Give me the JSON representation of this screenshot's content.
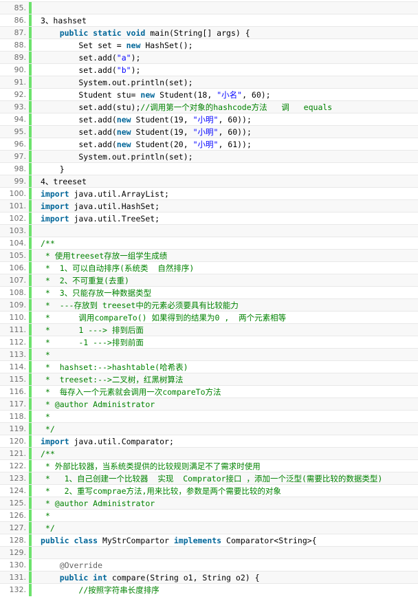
{
  "viewer": {
    "kind": "code-listing",
    "first_line": 85,
    "last_line": 132
  },
  "lines": [
    {
      "n": "85.",
      "t": []
    },
    {
      "n": "86.",
      "t": [
        [
          "blk",
          "3、hashset"
        ]
      ]
    },
    {
      "n": "87.",
      "t": [
        [
          "blk",
          "    "
        ],
        [
          "kw",
          "public static void"
        ],
        [
          "blk",
          " main(String[] args) {"
        ]
      ]
    },
    {
      "n": "88.",
      "t": [
        [
          "blk",
          "        Set set = "
        ],
        [
          "kw",
          "new"
        ],
        [
          "blk",
          " HashSet();"
        ]
      ]
    },
    {
      "n": "89.",
      "t": [
        [
          "blk",
          "        set.add("
        ],
        [
          "str",
          "\"a\""
        ],
        [
          "blk",
          ");"
        ]
      ]
    },
    {
      "n": "90.",
      "t": [
        [
          "blk",
          "        set.add("
        ],
        [
          "str",
          "\"b\""
        ],
        [
          "blk",
          ");"
        ]
      ]
    },
    {
      "n": "91.",
      "t": [
        [
          "blk",
          "        System.out.println(set);"
        ]
      ]
    },
    {
      "n": "92.",
      "t": [
        [
          "blk",
          "        Student stu= "
        ],
        [
          "kw",
          "new"
        ],
        [
          "blk",
          " Student(18, "
        ],
        [
          "str",
          "\"小名\""
        ],
        [
          "blk",
          ", 60);"
        ]
      ]
    },
    {
      "n": "93.",
      "t": [
        [
          "blk",
          "        set.add(stu);"
        ],
        [
          "cm",
          "//调用第一个对象的hashcode方法   调   equals"
        ]
      ]
    },
    {
      "n": "94.",
      "t": [
        [
          "blk",
          "        set.add("
        ],
        [
          "kw",
          "new"
        ],
        [
          "blk",
          " Student(19, "
        ],
        [
          "str",
          "\"小明\""
        ],
        [
          "blk",
          ", 60));"
        ]
      ]
    },
    {
      "n": "95.",
      "t": [
        [
          "blk",
          "        set.add("
        ],
        [
          "kw",
          "new"
        ],
        [
          "blk",
          " Student(19, "
        ],
        [
          "str",
          "\"小明\""
        ],
        [
          "blk",
          ", 60));"
        ]
      ]
    },
    {
      "n": "96.",
      "t": [
        [
          "blk",
          "        set.add("
        ],
        [
          "kw",
          "new"
        ],
        [
          "blk",
          " Student(20, "
        ],
        [
          "str",
          "\"小明\""
        ],
        [
          "blk",
          ", 61));"
        ]
      ]
    },
    {
      "n": "97.",
      "t": [
        [
          "blk",
          "        System.out.println(set);"
        ]
      ]
    },
    {
      "n": "98.",
      "t": [
        [
          "blk",
          "    }"
        ]
      ]
    },
    {
      "n": "99.",
      "t": [
        [
          "blk",
          "4、treeset"
        ]
      ]
    },
    {
      "n": "100.",
      "t": [
        [
          "kw",
          "import"
        ],
        [
          "blk",
          " java.util.ArrayList;"
        ]
      ]
    },
    {
      "n": "101.",
      "t": [
        [
          "kw",
          "import"
        ],
        [
          "blk",
          " java.util.HashSet;"
        ]
      ]
    },
    {
      "n": "102.",
      "t": [
        [
          "kw",
          "import"
        ],
        [
          "blk",
          " java.util.TreeSet;"
        ]
      ]
    },
    {
      "n": "103.",
      "t": []
    },
    {
      "n": "104.",
      "t": [
        [
          "cm",
          "/**"
        ]
      ]
    },
    {
      "n": "105.",
      "t": [
        [
          "cm",
          " * 使用treeset存放一组学生成绩"
        ]
      ]
    },
    {
      "n": "106.",
      "t": [
        [
          "cm",
          " *  1、可以自动排序(系统类  自然排序)"
        ]
      ]
    },
    {
      "n": "107.",
      "t": [
        [
          "cm",
          " *  2、不可重复(去重)"
        ]
      ]
    },
    {
      "n": "108.",
      "t": [
        [
          "cm",
          " *  3、只能存放一种数据类型"
        ]
      ]
    },
    {
      "n": "109.",
      "t": [
        [
          "cm",
          " *  ---存放到 treeset中的元素必须要具有比较能力"
        ]
      ]
    },
    {
      "n": "110.",
      "t": [
        [
          "cm",
          " *      调用compareTo() 如果得到的结果为0 ,  两个元素相等"
        ]
      ]
    },
    {
      "n": "111.",
      "t": [
        [
          "cm",
          " *      1 ---> 排到后面"
        ]
      ]
    },
    {
      "n": "112.",
      "t": [
        [
          "cm",
          " *      -1 --->排到前面"
        ]
      ]
    },
    {
      "n": "113.",
      "t": [
        [
          "cm",
          " *"
        ]
      ]
    },
    {
      "n": "114.",
      "t": [
        [
          "cm",
          " *  hashset:-->hashtable(哈希表)"
        ]
      ]
    },
    {
      "n": "115.",
      "t": [
        [
          "cm",
          " *  treeset:-->二叉树，红黑树算法"
        ]
      ]
    },
    {
      "n": "116.",
      "t": [
        [
          "cm",
          " *  每存入一个元素就会调用一次compareTo方法"
        ]
      ]
    },
    {
      "n": "117.",
      "t": [
        [
          "cm",
          " * @author Administrator"
        ]
      ]
    },
    {
      "n": "118.",
      "t": [
        [
          "cm",
          " *"
        ]
      ]
    },
    {
      "n": "119.",
      "t": [
        [
          "cm",
          " */"
        ]
      ]
    },
    {
      "n": "120.",
      "t": [
        [
          "kw",
          "import"
        ],
        [
          "blk",
          " java.util.Comparator;"
        ]
      ]
    },
    {
      "n": "121.",
      "t": [
        [
          "cm",
          "/**"
        ]
      ]
    },
    {
      "n": "122.",
      "t": [
        [
          "cm",
          " * 外部比较器，当系统类提供的比较规则满足不了需求时使用"
        ]
      ]
    },
    {
      "n": "123.",
      "t": [
        [
          "cm",
          " *   1、自己创建一个比较器  实现  Comprator接口 ，添加一个泛型(需要比较的数据类型)"
        ]
      ]
    },
    {
      "n": "124.",
      "t": [
        [
          "cm",
          " *   2、重写comprae方法,用来比较，参数是两个需要比较的对象"
        ]
      ]
    },
    {
      "n": "125.",
      "t": [
        [
          "cm",
          " * @author Administrator"
        ]
      ]
    },
    {
      "n": "126.",
      "t": [
        [
          "cm",
          " *"
        ]
      ]
    },
    {
      "n": "127.",
      "t": [
        [
          "cm",
          " */"
        ]
      ]
    },
    {
      "n": "128.",
      "t": [
        [
          "kw",
          "public class"
        ],
        [
          "blk",
          " MyStrCompartor "
        ],
        [
          "kw",
          "implements"
        ],
        [
          "blk",
          " Comparator<String>{"
        ]
      ]
    },
    {
      "n": "129.",
      "t": []
    },
    {
      "n": "130.",
      "t": [
        [
          "blk",
          "    "
        ],
        [
          "ann",
          "@Override"
        ]
      ]
    },
    {
      "n": "131.",
      "t": [
        [
          "blk",
          "    "
        ],
        [
          "kw",
          "public int"
        ],
        [
          "blk",
          " compare(String o1, String o2) {"
        ]
      ]
    },
    {
      "n": "132.",
      "t": [
        [
          "blk",
          "        "
        ],
        [
          "cm",
          "//按照字符串长度排序"
        ]
      ]
    }
  ],
  "colors": {
    "gutter_bar": "#6ce26c",
    "line_number": "#6d6d6d",
    "keyword": "#006699",
    "comment": "#008200",
    "string": "#0000ff"
  }
}
